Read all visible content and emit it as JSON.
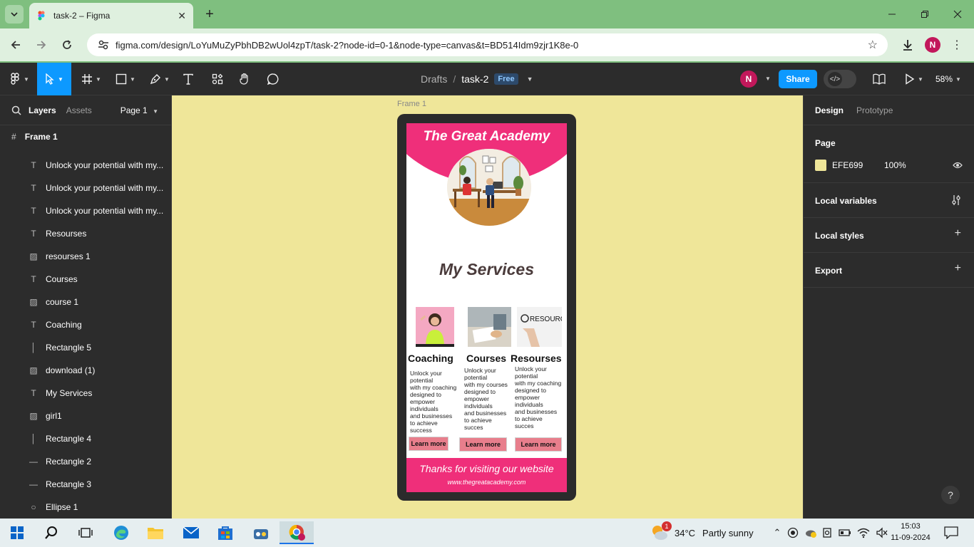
{
  "browser": {
    "tab_title": "task-2 – Figma",
    "new_tab": "+",
    "url": "figma.com/design/LoYuMuZyPbhDB2wUol4zpT/task-2?node-id=0-1&node-type=canvas&t=BD514Idm9zjr1K8e-0",
    "profile_initial": "N"
  },
  "figma": {
    "breadcrumb": {
      "drafts": "Drafts",
      "sep": "/",
      "file": "task-2",
      "plan": "Free"
    },
    "user_initial": "N",
    "share_label": "Share",
    "zoom": "58%"
  },
  "left_panel": {
    "tabs": {
      "layers": "Layers",
      "assets": "Assets",
      "page": "Page 1"
    },
    "frame": "Frame 1",
    "layers": [
      {
        "type": "text",
        "name": "Unlock your potential with my..."
      },
      {
        "type": "text",
        "name": "Unlock your potential with my..."
      },
      {
        "type": "text",
        "name": "Unlock your potential with my..."
      },
      {
        "type": "text",
        "name": "Resourses"
      },
      {
        "type": "image",
        "name": "resourses 1"
      },
      {
        "type": "text",
        "name": "Courses"
      },
      {
        "type": "image",
        "name": "course 1"
      },
      {
        "type": "text",
        "name": "Coaching"
      },
      {
        "type": "vline",
        "name": "Rectangle 5"
      },
      {
        "type": "image",
        "name": "download (1)"
      },
      {
        "type": "text",
        "name": "My Services"
      },
      {
        "type": "image",
        "name": "girl1"
      },
      {
        "type": "vline",
        "name": "Rectangle 4"
      },
      {
        "type": "hline",
        "name": "Rectangle 2"
      },
      {
        "type": "hline",
        "name": "Rectangle 3"
      },
      {
        "type": "ellipse",
        "name": "Ellipse 1"
      }
    ]
  },
  "canvas": {
    "frame_label": "Frame 1",
    "academy_title": "The Great Academy",
    "services_title": "My Services",
    "cards": [
      {
        "title": "Coaching",
        "body": "Unlock your\npotential\nwith my coaching\ndesigned to\nempower\nindividuals\nand businesses\nto achieve\nsuccess",
        "button": "Learn more"
      },
      {
        "title": "Courses",
        "body": "Unlock your\npotential\nwith my courses\ndesigned to\nempower\nindividuals\nand businesses\nto achieve\nsucces",
        "button": "Learn more"
      },
      {
        "title": "Resourses",
        "body": "Unlock your\npotential\nwith my coaching\ndesigned to\nempower\nindividuals\nand businesses\nto achieve\nsucces",
        "button": "Learn more"
      }
    ],
    "resources_sign": "RESOURCES",
    "thanks": "Thanks for visiting our website",
    "website": "www.thegreatacademy.com"
  },
  "right_panel": {
    "tabs": {
      "design": "Design",
      "prototype": "Prototype"
    },
    "page_heading": "Page",
    "page_color_hex": "EFE699",
    "page_opacity": "100%",
    "local_variables": "Local variables",
    "local_styles": "Local styles",
    "export": "Export"
  },
  "help": "?",
  "taskbar": {
    "weather_temp": "34°C",
    "weather_desc": "Partly sunny",
    "weather_badge": "1",
    "time": "15:03",
    "date": "11-09-2024"
  },
  "colors": {
    "figma_blue": "#0d99ff",
    "canvas_bg": "#efe699",
    "brand_pink": "#ef2f7a",
    "learn_button": "#e87e8c",
    "chrome_green": "#7fbf7f"
  }
}
